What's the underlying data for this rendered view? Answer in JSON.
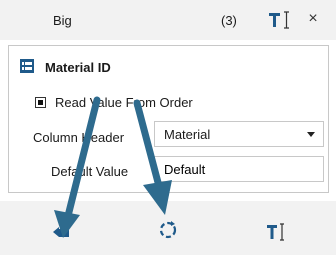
{
  "header": {
    "title": "Big",
    "count": "(3)",
    "text_tool_icon": "text-cursor-icon",
    "close_glyph": "×"
  },
  "section": {
    "icon": "table-icon",
    "title": "Material ID"
  },
  "checkbox": {
    "label": "Read Value From Order",
    "checked": true
  },
  "column_header": {
    "label": "Column Header",
    "value": "Material"
  },
  "default_value": {
    "label": "Default Value",
    "value": "Default"
  },
  "footer": {
    "icons": [
      "back-icon",
      "refresh-icon",
      "text-cursor-icon"
    ]
  },
  "colors": {
    "accent": "#1f5a8a",
    "arrow": "#2e6b8e",
    "header_bg": "#f2f2f2"
  }
}
